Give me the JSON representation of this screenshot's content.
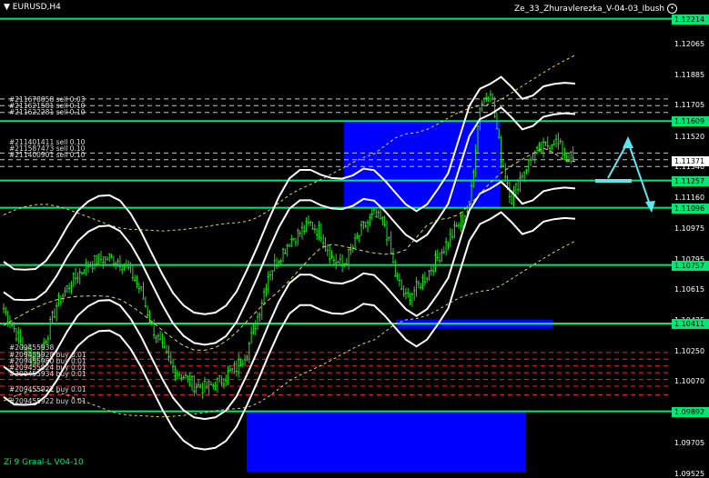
{
  "window": {
    "symbol_title": "EURUSD,H4",
    "expert_name": "Ze_33_Zhuravlerezka_V-04-03_Ibush",
    "indicator_label": "Zi 9 Graal-L V04-10"
  },
  "price_scale": {
    "max": 1.12325,
    "min": 1.09535,
    "tick_labels": [
      "1.12065",
      "1.11885",
      "1.11705",
      "1.11520",
      "1.11340",
      "1.11160",
      "1.10975",
      "1.10795",
      "1.10615",
      "1.10435",
      "1.10250",
      "1.10070",
      "1.09885",
      "1.09705",
      "1.09525"
    ],
    "level_labels": [
      "1.12214",
      "1.11609",
      "1.11257",
      "1.11096",
      "1.10757",
      "1.10411",
      "1.09892"
    ],
    "current_price_label": "1.11371"
  },
  "orders_top": [
    "#211678858 sell 0.03",
    "#211621581 sell 0.10",
    "#211622281 sell 0.10",
    "#211401411 sell 0.10",
    "#211587473 sell 0.10",
    "#211400901 sell 0.10"
  ],
  "orders_bottom": [
    "#209455938",
    "#209455928 buy 0.01",
    "#209455980 buy 0.01",
    "#209455924 buy 0.01",
    "#209455934 buy 0.01",
    "#209455922 buy 0.01",
    "#209455922 buy 0.01"
  ],
  "colors": {
    "background": "#000000",
    "level_line": "#00e676",
    "candles": "#22dd22",
    "zone": "#0000ff",
    "band": "#ffffff",
    "ma": "#e6d84a",
    "sell_line": "#c8c8c8",
    "buy_line": "#ff2222",
    "forecast": "#5ee6ee"
  },
  "chart_data": {
    "type": "candlestick",
    "symbol": "EURUSD",
    "timeframe": "H4",
    "levels": [
      1.12214,
      1.11609,
      1.11257,
      1.11096,
      1.10757,
      1.10411,
      1.09892
    ],
    "zones": [
      {
        "from_price": 1.11096,
        "to_price": 1.11609
      },
      {
        "from_price": 1.1038,
        "to_price": 1.10435
      },
      {
        "from_price": 1.09535,
        "to_price": 1.09892
      }
    ],
    "sell_levels": [
      1.1174,
      1.117,
      1.1166,
      1.1142,
      1.1138,
      1.1134
    ],
    "buy_levels": [
      1.1024,
      1.102,
      1.1016,
      1.1012,
      1.1008,
      1.1004,
      1.0999
    ],
    "close_path": [
      1.105,
      1.1038,
      1.1025,
      1.102,
      1.1032,
      1.1052,
      1.1062,
      1.107,
      1.1076,
      1.1079,
      1.108,
      1.1078,
      1.1072,
      1.106,
      1.104,
      1.1026,
      1.1015,
      1.101,
      1.1005,
      1.1003,
      1.1005,
      1.101,
      1.1015,
      1.1025,
      1.1045,
      1.107,
      1.108,
      1.109,
      1.1095,
      1.11,
      1.1095,
      1.108,
      1.1075,
      1.1086,
      1.1098,
      1.1105,
      1.11,
      1.107,
      1.1056,
      1.1062,
      1.107,
      1.108,
      1.109,
      1.11,
      1.111,
      1.117,
      1.118,
      1.114,
      1.1115,
      1.113,
      1.114,
      1.1145,
      1.115,
      1.1142,
      1.11371
    ]
  }
}
